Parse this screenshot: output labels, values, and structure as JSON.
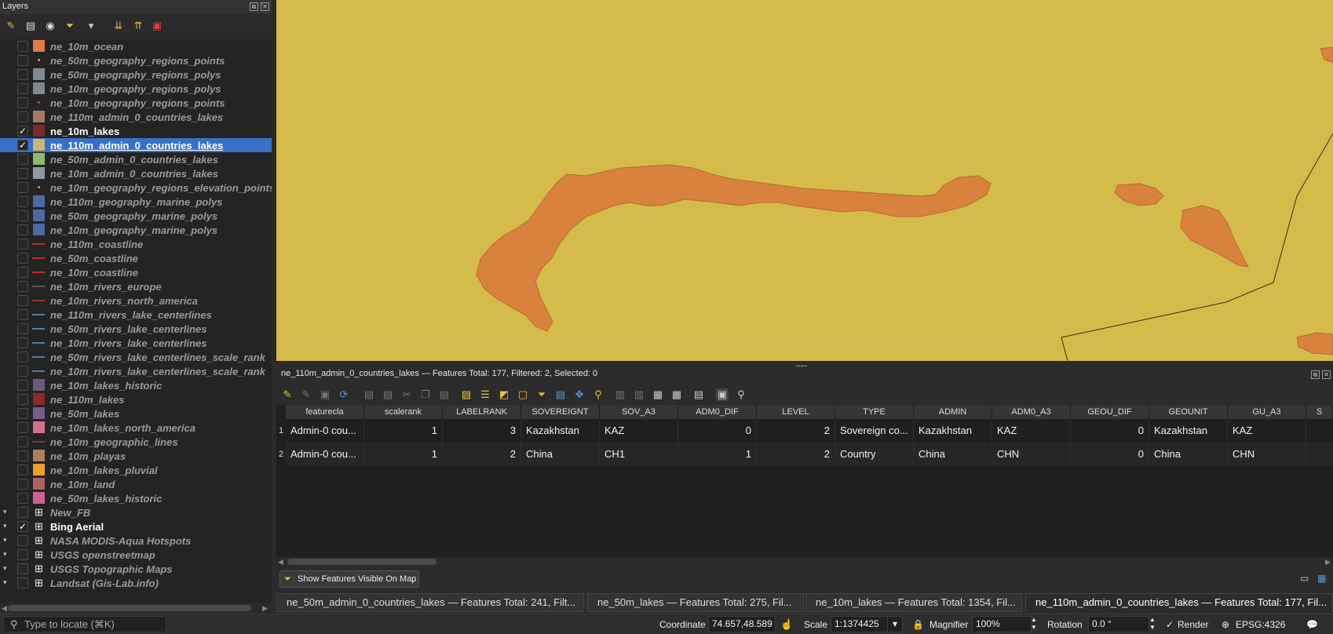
{
  "layers_panel": {
    "title": "Layers",
    "toolbar_icons": [
      "open-layer-styling-icon",
      "add-group-icon",
      "manage-visibility-icon",
      "filter-legend-icon",
      "filter-by-expression-icon",
      "expand-all-icon",
      "collapse-all-icon",
      "remove-layer-icon"
    ],
    "layers": [
      {
        "name": "ne_10m_ocean",
        "checked": false,
        "symbol": "fill",
        "color": "#e07a4a",
        "expander": false
      },
      {
        "name": "ne_50m_geography_regions_points",
        "checked": false,
        "symbol": "point",
        "color": "#b7c43a",
        "expander": false
      },
      {
        "name": "ne_50m_geography_regions_polys",
        "checked": false,
        "symbol": "fill",
        "color": "#7f8a94",
        "expander": false
      },
      {
        "name": "ne_10m_geography_regions_polys",
        "checked": false,
        "symbol": "fill",
        "color": "#7d8891",
        "expander": false
      },
      {
        "name": "ne_10m_geography_regions_points",
        "checked": false,
        "symbol": "point",
        "color": "#d04040",
        "expander": false
      },
      {
        "name": "ne_110m_admin_0_countries_lakes",
        "checked": false,
        "symbol": "fill",
        "color": "#a47a62",
        "expander": false
      },
      {
        "name": "ne_10m_lakes",
        "checked": true,
        "symbol": "fill",
        "color": "#7a2a2a",
        "expander": false
      },
      {
        "name": "ne_110m_admin_0_countries_lakes",
        "checked": true,
        "symbol": "fill",
        "color": "#c9b870",
        "expander": false,
        "selected": true
      },
      {
        "name": "ne_50m_admin_0_countries_lakes",
        "checked": false,
        "symbol": "fill",
        "color": "#8fb86a",
        "expander": false
      },
      {
        "name": "ne_10m_admin_0_countries_lakes",
        "checked": false,
        "symbol": "fill",
        "color": "#8f9aa0",
        "expander": false
      },
      {
        "name": "ne_10m_geography_regions_elevation_points",
        "checked": false,
        "symbol": "point",
        "color": "#e0a040",
        "expander": false
      },
      {
        "name": "ne_110m_geography_marine_polys",
        "checked": false,
        "symbol": "fill",
        "color": "#4a6aa0",
        "expander": false
      },
      {
        "name": "ne_50m_geography_marine_polys",
        "checked": false,
        "symbol": "fill",
        "color": "#4a6aa0",
        "expander": false
      },
      {
        "name": "ne_10m_geography_marine_polys",
        "checked": false,
        "symbol": "fill",
        "color": "#4a6aa0",
        "expander": false
      },
      {
        "name": "ne_110m_coastline",
        "checked": false,
        "symbol": "line",
        "color": "#c03030",
        "expander": false
      },
      {
        "name": "ne_50m_coastline",
        "checked": false,
        "symbol": "line",
        "color": "#c03030",
        "expander": false
      },
      {
        "name": "ne_10m_coastline",
        "checked": false,
        "symbol": "line",
        "color": "#c03030",
        "expander": false
      },
      {
        "name": "ne_10m_rivers_europe",
        "checked": false,
        "symbol": "line",
        "color": "#555555",
        "expander": false
      },
      {
        "name": "ne_10m_rivers_north_america",
        "checked": false,
        "symbol": "line",
        "color": "#a03030",
        "expander": false
      },
      {
        "name": "ne_110m_rivers_lake_centerlines",
        "checked": false,
        "symbol": "line",
        "color": "#5a7aa0",
        "expander": false
      },
      {
        "name": "ne_50m_rivers_lake_centerlines",
        "checked": false,
        "symbol": "line",
        "color": "#5a7aa0",
        "expander": false
      },
      {
        "name": "ne_10m_rivers_lake_centerlines",
        "checked": false,
        "symbol": "line",
        "color": "#5a7aa0",
        "expander": false
      },
      {
        "name": "ne_50m_rivers_lake_centerlines_scale_rank",
        "checked": false,
        "symbol": "line",
        "color": "#5a7aa0",
        "expander": false
      },
      {
        "name": "ne_10m_rivers_lake_centerlines_scale_rank",
        "checked": false,
        "symbol": "line",
        "color": "#5a7aa0",
        "expander": false
      },
      {
        "name": "ne_10m_lakes_historic",
        "checked": false,
        "symbol": "fill",
        "color": "#6a5a80",
        "expander": false
      },
      {
        "name": "ne_110m_lakes",
        "checked": false,
        "symbol": "fill",
        "color": "#8a2a2a",
        "expander": false
      },
      {
        "name": "ne_50m_lakes",
        "checked": false,
        "symbol": "fill",
        "color": "#7a5a8a",
        "expander": false
      },
      {
        "name": "ne_10m_lakes_north_america",
        "checked": false,
        "symbol": "fill",
        "color": "#d07090",
        "expander": false
      },
      {
        "name": "ne_10m_geographic_lines",
        "checked": false,
        "symbol": "line",
        "color": "#4a4a4a",
        "expander": false
      },
      {
        "name": "ne_10m_playas",
        "checked": false,
        "symbol": "fill",
        "color": "#a88060",
        "expander": false
      },
      {
        "name": "ne_10m_lakes_pluvial",
        "checked": false,
        "symbol": "fill",
        "color": "#e8a030",
        "expander": false
      },
      {
        "name": "ne_10m_land",
        "checked": false,
        "symbol": "fill",
        "color": "#b06060",
        "expander": false
      },
      {
        "name": "ne_50m_lakes_historic",
        "checked": false,
        "symbol": "fill",
        "color": "#d06090",
        "expander": false
      },
      {
        "name": "New_FB",
        "checked": false,
        "symbol": "raster",
        "color": "#e0e0e0",
        "expander": true
      },
      {
        "name": "Bing Aerial",
        "checked": true,
        "symbol": "raster",
        "color": "#e0e0e0",
        "expander": true
      },
      {
        "name": "NASA MODIS-Aqua Hotspots",
        "checked": false,
        "symbol": "raster",
        "color": "#e0e0e0",
        "expander": true
      },
      {
        "name": "USGS openstreetmap",
        "checked": false,
        "symbol": "raster",
        "color": "#e0e0e0",
        "expander": true
      },
      {
        "name": "USGS Topographic Maps",
        "checked": false,
        "symbol": "raster",
        "color": "#e0e0e0",
        "expander": true
      },
      {
        "name": "Landsat (Gis-Lab.info)",
        "checked": false,
        "symbol": "raster",
        "color": "#e0e0e0",
        "expander": true
      }
    ]
  },
  "map": {
    "background_color": "#d4bb4a",
    "lake_color": "#d9823e",
    "lake_stroke": "#b86a30"
  },
  "attribute_table": {
    "title": "ne_110m_admin_0_countries_lakes — Features Total: 177, Filtered: 2, Selected: 0",
    "columns": [
      "featurecla",
      "scalerank",
      "LABELRANK",
      "SOVEREIGNT",
      "SOV_A3",
      "ADM0_DIF",
      "LEVEL",
      "TYPE",
      "ADMIN",
      "ADM0_A3",
      "GEOU_DIF",
      "GEOUNIT",
      "GU_A3",
      "S"
    ],
    "rows": [
      {
        "num": "1",
        "cells": [
          "Admin-0 cou...",
          "1",
          "3",
          "Kazakhstan",
          "KAZ",
          "0",
          "2",
          "Sovereign co...",
          "Kazakhstan",
          "KAZ",
          "0",
          "Kazakhstan",
          "KAZ"
        ]
      },
      {
        "num": "2",
        "cells": [
          "Admin-0 cou...",
          "1",
          "2",
          "China",
          "CH1",
          "1",
          "2",
          "Country",
          "China",
          "CHN",
          "0",
          "China",
          "CHN"
        ]
      }
    ],
    "filter_button": "Show Features Visible On Map",
    "tabs": [
      "ne_50m_admin_0_countries_lakes — Features Total: 241, Filt...",
      "ne_50m_lakes — Features Total: 275, Fil...",
      "ne_10m_lakes — Features Total: 1354, Fil...",
      "ne_110m_admin_0_countries_lakes — Features Total: 177, Fil..."
    ]
  },
  "status_bar": {
    "locator_placeholder": "Type to locate (⌘K)",
    "coordinate_label": "Coordinate",
    "coordinate_value": "74.657,48.589",
    "scale_label": "Scale",
    "scale_value": "1:1374425",
    "magnifier_label": "Magnifier",
    "magnifier_value": "100%",
    "rotation_label": "Rotation",
    "rotation_value": "0.0 °",
    "render_label": "Render",
    "crs_label": "EPSG:4326"
  }
}
